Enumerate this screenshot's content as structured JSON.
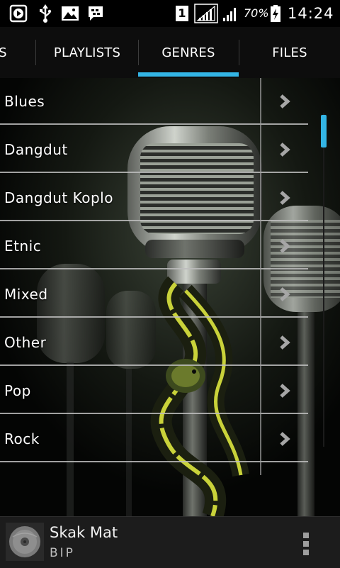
{
  "status_bar": {
    "icons": [
      "play-notification-icon",
      "usb-icon",
      "image-icon",
      "bbm-icon",
      "sim-1-icon",
      "signal-strength-icon",
      "signal-strength-2-icon",
      "battery-charging-icon"
    ],
    "sim_label": "1",
    "battery": "70%",
    "time": "14:24"
  },
  "tabs": {
    "items": [
      {
        "label": "S"
      },
      {
        "label": "PLAYLISTS"
      },
      {
        "label": "GENRES",
        "active": true
      },
      {
        "label": "FILES"
      }
    ],
    "accent": "#33b5e5"
  },
  "genres": {
    "items": [
      {
        "label": "Blues"
      },
      {
        "label": "Dangdut"
      },
      {
        "label": "Dangdut Koplo"
      },
      {
        "label": "Etnic"
      },
      {
        "label": "Mixed"
      },
      {
        "label": "Other"
      },
      {
        "label": "Pop"
      },
      {
        "label": "Rock"
      }
    ]
  },
  "now_playing": {
    "title": "Skak Mat",
    "artist": "BIP",
    "icon": "album-art-icon",
    "menu_icon": "overflow-menu-icon"
  }
}
